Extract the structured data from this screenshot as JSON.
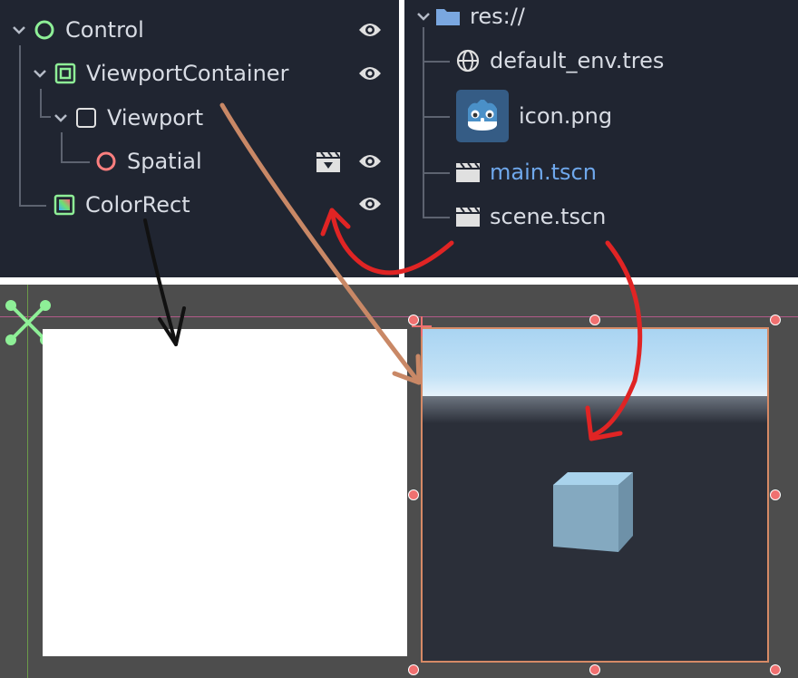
{
  "scene_tree": {
    "nodes": [
      {
        "label": "Control",
        "icon": "control-circle-icon",
        "visible_toggle": true
      },
      {
        "label": "ViewportContainer",
        "icon": "viewport-container-icon",
        "visible_toggle": true
      },
      {
        "label": "Viewport",
        "icon": "viewport-icon",
        "visible_toggle": false
      },
      {
        "label": "Spatial",
        "icon": "spatial-circle-icon",
        "visible_toggle": true,
        "has_scene_icon": true
      },
      {
        "label": "ColorRect",
        "icon": "color-rect-icon",
        "visible_toggle": true
      }
    ]
  },
  "filesystem": {
    "root": "res://",
    "items": [
      {
        "label": "default_env.tres",
        "icon": "globe-icon"
      },
      {
        "label": "icon.png",
        "icon": "godot-logo-icon"
      },
      {
        "label": "main.tscn",
        "icon": "clapper-icon",
        "highlighted": true
      },
      {
        "label": "scene.tscn",
        "icon": "clapper-icon"
      }
    ]
  },
  "colors": {
    "panel_bg": "#202531",
    "text": "#d8dce4",
    "link": "#6fa8ec",
    "viewport_border": "#d68a66",
    "handle": "#f07070",
    "control_icon": "#8eef97",
    "spatial_icon": "#fc7f7f"
  }
}
